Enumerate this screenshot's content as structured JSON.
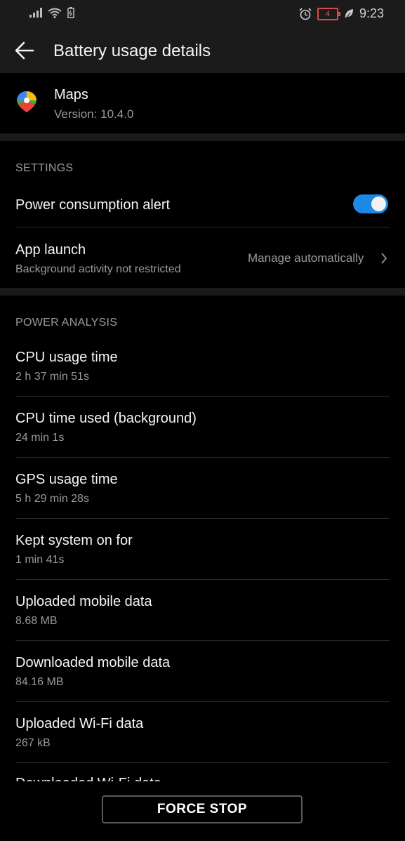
{
  "status_bar": {
    "time": "9:23",
    "battery_level": "4",
    "icons": [
      "signal-icon",
      "wifi-icon",
      "battery-saver-icon",
      "alarm-icon",
      "battery-icon",
      "leaf-icon"
    ]
  },
  "header": {
    "title": "Battery usage details"
  },
  "app": {
    "name": "Maps",
    "version": "Version: 10.4.0"
  },
  "settings": {
    "header": "SETTINGS",
    "power_alert": {
      "label": "Power consumption alert",
      "enabled": true
    },
    "app_launch": {
      "label": "App launch",
      "sub": "Background activity not restricted",
      "value": "Manage automatically"
    }
  },
  "power_analysis": {
    "header": "POWER ANALYSIS",
    "items": [
      {
        "title": "CPU usage time",
        "value": "2 h 37 min 51s"
      },
      {
        "title": "CPU time used (background)",
        "value": "24 min 1s"
      },
      {
        "title": "GPS usage time",
        "value": "5 h 29 min 28s"
      },
      {
        "title": "Kept system on for",
        "value": "1 min 41s"
      },
      {
        "title": "Uploaded mobile data",
        "value": "8.68 MB"
      },
      {
        "title": "Downloaded mobile data",
        "value": "84.16 MB"
      },
      {
        "title": "Uploaded Wi-Fi data",
        "value": "267 kB"
      }
    ],
    "partial_item": "Downloaded Wi-Fi data"
  },
  "actions": {
    "force_stop": "FORCE STOP"
  },
  "colors": {
    "accent": "#1e88e5",
    "background": "#000000",
    "bar": "#1b1b1b"
  }
}
